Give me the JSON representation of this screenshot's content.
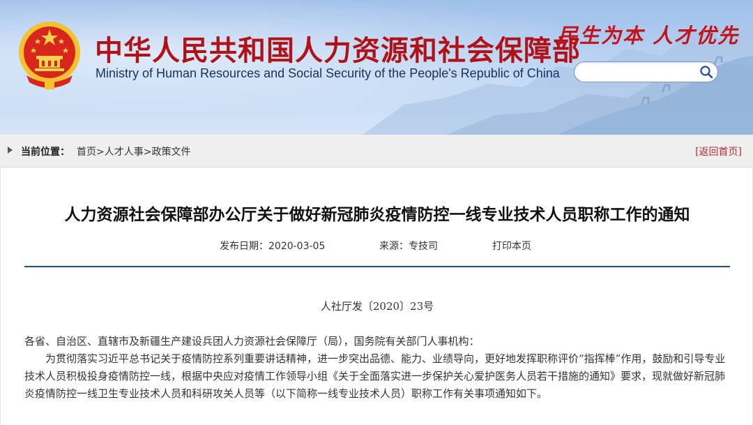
{
  "header": {
    "title_cn": "中华人民共和国人力资源和社会保障部",
    "title_en": "Ministry of Human Resources and Social Security of the People's Republic of China",
    "slogan": "民生为本 人才优先",
    "search": {
      "placeholder": ""
    },
    "colors": {
      "title": "#b01218",
      "slogan": "#c4141b",
      "banner_top": "#9fc0ea"
    }
  },
  "breadcrumb": {
    "label": "当前位置：",
    "items": [
      "首页",
      "人才人事",
      "政策文件"
    ],
    "separator": ">",
    "back_home": "[返回首页]"
  },
  "article": {
    "title": "人力资源社会保障部办公厅关于做好新冠肺炎疫情防控一线专业技术人员职称工作的通知",
    "meta": {
      "date_label": "发布日期：",
      "date": "2020-03-05",
      "source_label": "来源：",
      "source": "专技司",
      "print": "打印本页"
    },
    "doc_number": "人社厅发〔2020〕23号",
    "salutation": "各省、自治区、直辖市及新疆生产建设兵团人力资源社会保障厅（局），国务院有关部门人事机构：",
    "paragraph": "为贯彻落实习近平总书记关于疫情防控系列重要讲话精神，进一步突出品德、能力、业绩导向，更好地发挥职称评价“指挥棒”作用，鼓励和引导专业技术人员积极投身疫情防控一线，根据中央应对疫情工作领导小组《关于全面落实进一步保护关心爱护医务人员若干措施的通知》要求，现就做好新冠肺炎疫情防控一线卫生专业技术人员和科研攻关人员等（以下简称一线专业技术人员）职称工作有关事项通知如下。"
  }
}
